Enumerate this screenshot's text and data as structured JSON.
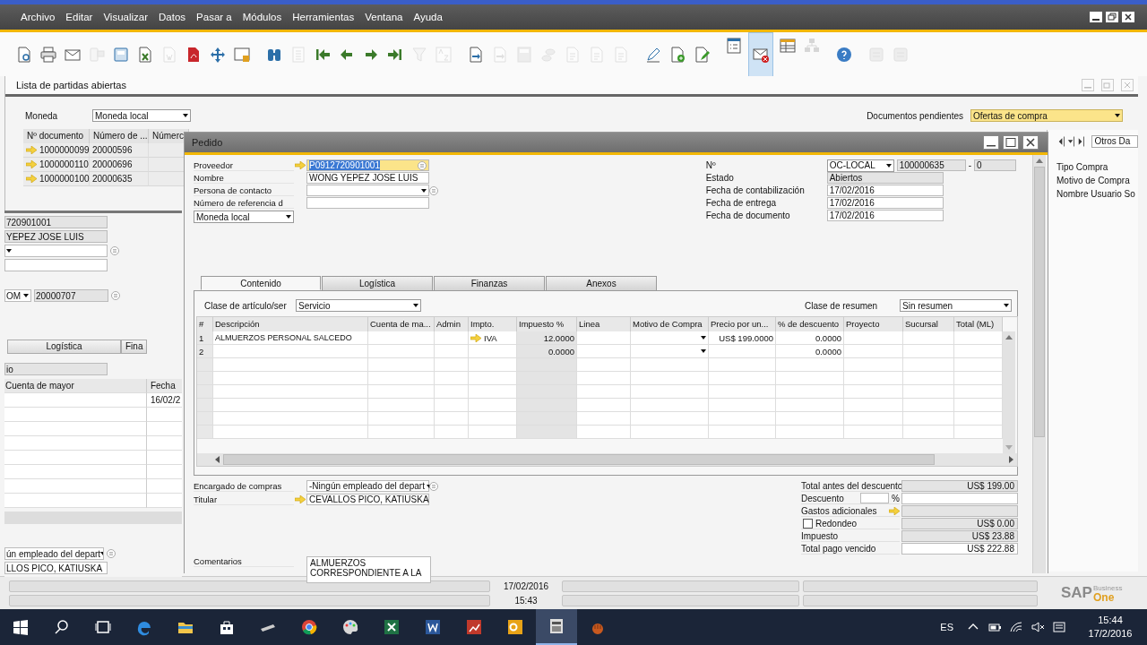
{
  "menu": [
    "Archivo",
    "Editar",
    "Visualizar",
    "Datos",
    "Pasar a",
    "Módulos",
    "Herramientas",
    "Ventana",
    "Ayuda"
  ],
  "toolbar": [
    [
      {
        "kind": "preview",
        "disabled": false,
        "selected": false
      },
      {
        "kind": "print",
        "disabled": false,
        "selected": false
      },
      {
        "kind": "email",
        "disabled": false,
        "selected": false
      },
      {
        "kind": "sms",
        "disabled": true,
        "selected": false
      },
      {
        "kind": "fax",
        "disabled": false,
        "selected": false
      },
      {
        "kind": "excel",
        "disabled": false,
        "selected": false
      },
      {
        "kind": "word",
        "disabled": true,
        "selected": false
      },
      {
        "kind": "pdf",
        "disabled": false,
        "selected": false
      },
      {
        "kind": "move",
        "disabled": false,
        "selected": false
      },
      {
        "kind": "lock",
        "disabled": false,
        "selected": false
      }
    ],
    [
      {
        "kind": "find",
        "disabled": false,
        "selected": false
      },
      {
        "kind": "list",
        "disabled": true,
        "selected": false
      },
      {
        "kind": "first",
        "disabled": false,
        "selected": false
      },
      {
        "kind": "prev",
        "disabled": false,
        "selected": false
      },
      {
        "kind": "next",
        "disabled": false,
        "selected": false
      },
      {
        "kind": "last",
        "disabled": false,
        "selected": false
      },
      {
        "kind": "filter",
        "disabled": true,
        "selected": false
      },
      {
        "kind": "sort",
        "disabled": true,
        "selected": false
      }
    ],
    [
      {
        "kind": "base",
        "disabled": false,
        "selected": false
      },
      {
        "kind": "target",
        "disabled": true,
        "selected": false
      },
      {
        "kind": "calc",
        "disabled": true,
        "selected": false
      },
      {
        "kind": "coins",
        "disabled": true,
        "selected": false
      },
      {
        "kind": "doc",
        "disabled": true,
        "selected": false
      },
      {
        "kind": "doc",
        "disabled": true,
        "selected": false
      },
      {
        "kind": "doc",
        "disabled": true,
        "selected": false
      }
    ],
    [
      {
        "kind": "pen",
        "disabled": false,
        "selected": false
      },
      {
        "kind": "docplus",
        "disabled": false,
        "selected": false
      },
      {
        "kind": "edit",
        "disabled": false,
        "selected": false
      }
    ],
    [
      {
        "kind": "checklist",
        "disabled": false,
        "selected": false
      },
      {
        "kind": "mailx",
        "disabled": false,
        "selected": true
      },
      {
        "kind": "grid",
        "disabled": false,
        "selected": false
      },
      {
        "kind": "tree",
        "disabled": true,
        "selected": false
      }
    ],
    [
      {
        "kind": "help",
        "disabled": false,
        "selected": false
      }
    ],
    [
      {
        "kind": "db",
        "disabled": true,
        "selected": false
      },
      {
        "kind": "db",
        "disabled": true,
        "selected": false
      }
    ]
  ],
  "lista": {
    "title": "Lista de partidas abiertas",
    "moneda": {
      "label": "Moneda",
      "value": "Moneda local"
    },
    "pendientes": {
      "label": "Documentos pendientes",
      "value": "Ofertas de compra"
    },
    "columns": [
      "Nº documento",
      "Número de ...",
      "Númerc"
    ],
    "rows": [
      [
        "1000000099",
        "20000596"
      ],
      [
        "1000000110",
        "20000696"
      ],
      [
        "1000000100",
        "20000635"
      ]
    ]
  },
  "back_window": {
    "code": "720901001",
    "name": "YEPEZ JOSE LUIS",
    "series": "OM",
    "number": "20000707",
    "tabs": [
      "Logística",
      "Fina"
    ],
    "item_class": "io",
    "columns": [
      "Cuenta de mayor",
      "Fecha"
    ],
    "first_date": "16/02/2",
    "buyer": "ún empleado del depart",
    "owner": "LLOS PICO, KATIUSKA"
  },
  "side_panel": {
    "field": "Otros Da",
    "labels": [
      "Tipo Compra",
      "Motivo de Compra",
      "Nombre Usuario So"
    ]
  },
  "pedido": {
    "title": "Pedido",
    "left_fields": [
      {
        "label": "Proveedor",
        "value": "P0912720901001",
        "kind": "link",
        "highlighted": true
      },
      {
        "label": "Nombre",
        "value": "WONG YEPEZ JOSE LUIS",
        "kind": "text"
      },
      {
        "label": "Persona de contacto",
        "kind": "dropdown"
      },
      {
        "label": "Número de referencia d",
        "kind": "text"
      }
    ],
    "currency": "Moneda local",
    "number": {
      "label": "Nº",
      "series": "OC-LOCAL",
      "value": "100000635",
      "separator": "-",
      "suffix": "0"
    },
    "right_fields": [
      {
        "label": "Estado",
        "value": "Abiertos",
        "readonly": true
      },
      {
        "label": "Fecha de contabilización",
        "value": "17/02/2016",
        "readonly": false
      },
      {
        "label": "Fecha de entrega",
        "value": "17/02/2016",
        "readonly": false
      },
      {
        "label": "Fecha de documento",
        "value": "17/02/2016",
        "readonly": false
      }
    ],
    "tabs": [
      {
        "label": "Contenido",
        "selected": true
      },
      {
        "label": "Logística",
        "selected": false
      },
      {
        "label": "Finanzas",
        "selected": false
      },
      {
        "label": "Anexos",
        "selected": false
      }
    ],
    "item_class": {
      "label": "Clase de artículo/ser",
      "value": "Servicio"
    },
    "summary_class": {
      "label": "Clase de resumen",
      "value": "Sin resumen"
    },
    "columns": [
      {
        "label": "#",
        "kind": "index"
      },
      {
        "label": "Descripción",
        "kind": "text"
      },
      {
        "label": "Cuenta de ma...",
        "kind": "text"
      },
      {
        "label": "Admin",
        "kind": "text"
      },
      {
        "label": "Impto.",
        "kind": "link"
      },
      {
        "label": "Impuesto %",
        "kind": "readonly"
      },
      {
        "label": "Linea",
        "kind": "text"
      },
      {
        "label": "Motivo de Compra",
        "kind": "dropdown"
      },
      {
        "label": "Precio por un...",
        "kind": "number"
      },
      {
        "label": "% de descuento",
        "kind": "number"
      },
      {
        "label": "Proyecto",
        "kind": "text"
      },
      {
        "label": "Sucursal",
        "kind": "text"
      },
      {
        "label": "Total (ML)",
        "kind": "text"
      }
    ],
    "rows": [
      [
        "1",
        "ALMUERZOS PERSONAL SALCEDO",
        null,
        null,
        "IVA",
        "12.0000",
        null,
        null,
        "US$ 199.0000",
        "0.0000",
        null,
        null,
        null
      ],
      [
        "2",
        null,
        null,
        null,
        null,
        "0.0000",
        null,
        null,
        null,
        "0.0000",
        null,
        null,
        null
      ]
    ],
    "buyer": {
      "label": "Encargado de compras",
      "value": "-Ningún empleado del depart"
    },
    "owner": {
      "label": "Titular",
      "value": "CEVALLOS PICO, KATIUSKA"
    },
    "comments": {
      "label": "Comentarios",
      "lines": [
        "ALMUERZOS",
        "CORRESPONDIENTE A LA"
      ]
    },
    "totals": [
      {
        "label": "Total antes del descuento",
        "kind": "readonly",
        "value": "US$ 199.00"
      },
      {
        "label": "Descuento",
        "kind": "percent",
        "unit": "%"
      },
      {
        "label": "Gastos adicionales",
        "kind": "link"
      },
      {
        "label": "Redondeo",
        "kind": "checkbox",
        "checked": false,
        "value": "US$ 0.00"
      },
      {
        "label": "Impuesto",
        "kind": "readonly",
        "value": "US$ 23.88"
      },
      {
        "label": "Total pago vencido",
        "kind": "editable",
        "value": "US$ 222.88"
      }
    ]
  },
  "status": {
    "date": "17/02/2016",
    "time": "15:43"
  },
  "logo": {
    "brand": "SAP",
    "line1": "Business",
    "line2": "One"
  },
  "taskbar": {
    "apps": [
      {
        "kind": "start",
        "active": false
      },
      {
        "kind": "search",
        "active": false
      },
      {
        "kind": "taskview",
        "active": false
      },
      {
        "kind": "edge",
        "active": false
      },
      {
        "kind": "folder",
        "active": false
      },
      {
        "kind": "store",
        "active": false
      },
      {
        "kind": "stapler",
        "active": false
      },
      {
        "kind": "chrome",
        "active": false
      },
      {
        "kind": "paint",
        "active": false
      },
      {
        "kind": "excel",
        "active": false
      },
      {
        "kind": "word",
        "active": false
      },
      {
        "kind": "chart",
        "active": false
      },
      {
        "kind": "outlook",
        "active": false
      },
      {
        "kind": "sap",
        "active": true
      },
      {
        "kind": "glove",
        "active": false
      }
    ],
    "language": "ES",
    "time": "15:44",
    "date": "17/2/2016"
  }
}
